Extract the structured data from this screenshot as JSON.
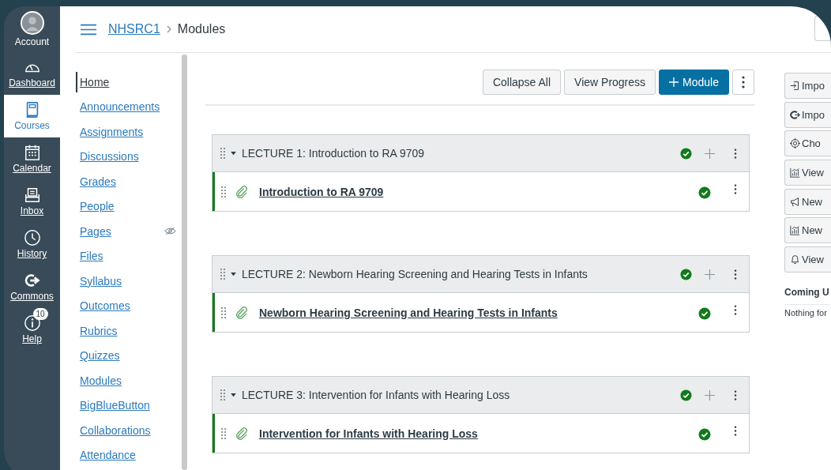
{
  "global_nav": [
    {
      "label": "Account",
      "kind": "account",
      "selected": false
    },
    {
      "label": "Dashboard",
      "kind": "dashboard",
      "selected": false
    },
    {
      "label": "Courses",
      "kind": "courses",
      "selected": true
    },
    {
      "label": "Calendar",
      "kind": "calendar",
      "selected": false
    },
    {
      "label": "Inbox",
      "kind": "inbox",
      "selected": false
    },
    {
      "label": "History",
      "kind": "history",
      "selected": false
    },
    {
      "label": "Commons",
      "kind": "commons",
      "selected": false
    },
    {
      "label": "Help",
      "kind": "help",
      "selected": false,
      "badge": "10"
    }
  ],
  "breadcrumb": [
    "NHSRC1",
    "Modules"
  ],
  "course_nav": [
    {
      "label": "Home",
      "selected": true,
      "hidden": false
    },
    {
      "label": "Announcements",
      "selected": false,
      "hidden": false
    },
    {
      "label": "Assignments",
      "selected": false,
      "hidden": false
    },
    {
      "label": "Discussions",
      "selected": false,
      "hidden": false
    },
    {
      "label": "Grades",
      "selected": false,
      "hidden": false
    },
    {
      "label": "People",
      "selected": false,
      "hidden": false
    },
    {
      "label": "Pages",
      "selected": false,
      "hidden": true
    },
    {
      "label": "Files",
      "selected": false,
      "hidden": false
    },
    {
      "label": "Syllabus",
      "selected": false,
      "hidden": false
    },
    {
      "label": "Outcomes",
      "selected": false,
      "hidden": false
    },
    {
      "label": "Rubrics",
      "selected": false,
      "hidden": false
    },
    {
      "label": "Quizzes",
      "selected": false,
      "hidden": false
    },
    {
      "label": "Modules",
      "selected": false,
      "hidden": false
    },
    {
      "label": "BigBlueButton",
      "selected": false,
      "hidden": false
    },
    {
      "label": "Collaborations",
      "selected": false,
      "hidden": false
    },
    {
      "label": "Attendance",
      "selected": false,
      "hidden": false
    }
  ],
  "toolbar": [
    {
      "label": "Collapse All",
      "kind": "plain"
    },
    {
      "label": "View Progress",
      "kind": "plain"
    },
    {
      "label": "Module",
      "kind": "primary"
    },
    {
      "kind": "more"
    }
  ],
  "modules": [
    {
      "title": "LECTURE 1: Introduction to RA 9709",
      "published": true,
      "expanded": true,
      "items": [
        {
          "title": "Introduction to RA 9709",
          "published": true
        }
      ]
    },
    {
      "title": "LECTURE 2: Newborn Hearing Screening and Hearing Tests in Infants",
      "published": true,
      "expanded": true,
      "items": [
        {
          "title": "Newborn Hearing Screening and Hearing Tests in Infants",
          "published": true
        }
      ]
    },
    {
      "title": "LECTURE 3: Intervention for Infants with Hearing Loss",
      "published": true,
      "expanded": true,
      "items": [
        {
          "title": "Intervention for Infants with Hearing Loss",
          "published": true
        }
      ]
    }
  ],
  "sidebar": {
    "buttons": [
      {
        "label": "Impo",
        "kind": "import"
      },
      {
        "label": "Impo",
        "kind": "import-commons"
      },
      {
        "label": "Cho",
        "kind": "choose"
      },
      {
        "label": "View",
        "kind": "stats"
      },
      {
        "label": "New",
        "kind": "announce"
      },
      {
        "label": "New",
        "kind": "stats"
      },
      {
        "label": "View",
        "kind": "bell"
      }
    ],
    "coming_up": {
      "title": "Coming U",
      "text": "Nothing for"
    }
  }
}
